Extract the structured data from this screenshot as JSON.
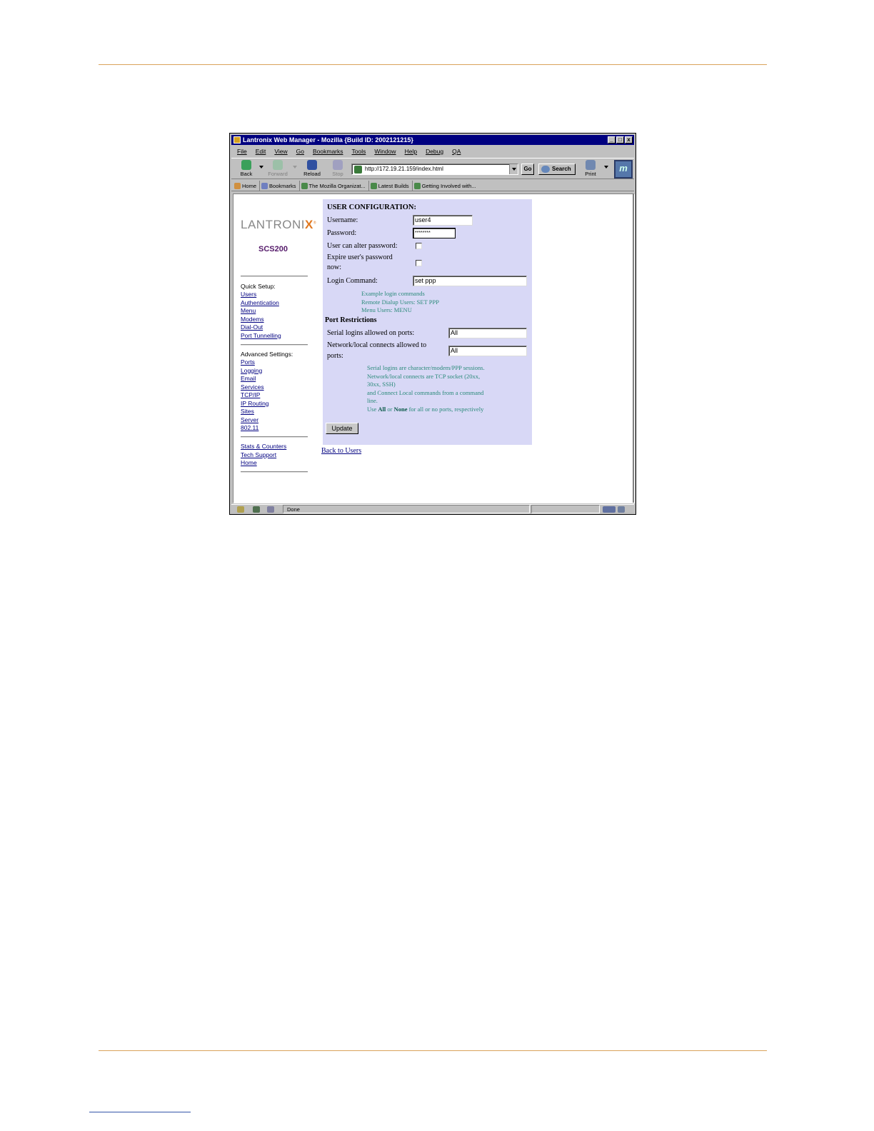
{
  "window": {
    "title": "Lantronix Web Manager - Mozilla {Build ID: 2002121215}",
    "buttons": [
      "_",
      "□",
      "x"
    ]
  },
  "menubar": [
    "File",
    "Edit",
    "View",
    "Go",
    "Bookmarks",
    "Tools",
    "Window",
    "Help",
    "Debug",
    "QA"
  ],
  "toolbar": {
    "back": "Back",
    "forward": "Forward",
    "reload": "Reload",
    "stop": "Stop",
    "url": "http://172.19.21.159/index.html",
    "go": "Go",
    "search": "Search",
    "print": "Print"
  },
  "personal_bar": [
    "Home",
    "Bookmarks",
    "The Mozilla Organizat...",
    "Latest Builds",
    "Getting Involved with..."
  ],
  "sidebar": {
    "logo_text": "LANTRONI",
    "logo_x": "X",
    "model": "SCS200",
    "quick_setup_heading": "Quick Setup:",
    "quick_setup": [
      "Users",
      "Authentication",
      "Menu",
      "Modems",
      "Dial-Out",
      "Port Tunnelling"
    ],
    "advanced_heading": "Advanced Settings:",
    "advanced": [
      "Ports",
      "Logging",
      "Email",
      "Services",
      "TCP/IP",
      "IP Routing",
      "Sites",
      "Server",
      "802.11"
    ],
    "misc": [
      "Stats & Counters",
      "Tech Support",
      "Home"
    ]
  },
  "form": {
    "heading": "USER CONFIGURATION:",
    "username_label": "Username:",
    "username_value": "user4",
    "password_label": "Password:",
    "password_value": "********",
    "alter_label": "User can alter password:",
    "expire_label_1": "Expire user's password",
    "expire_label_2": "now:",
    "login_label": "Login Command:",
    "login_value": "set ppp",
    "example_hint": [
      "Example login commands",
      "Remote Dialup Users: SET PPP",
      "Menu Users: MENU"
    ],
    "port_heading": "Port Restrictions",
    "serial_label": "Serial logins allowed on ports:",
    "serial_value": "All",
    "network_label_1": "Network/local connects allowed to",
    "network_label_2": "ports:",
    "network_value": "All",
    "port_hint": [
      "Serial logins are character/modem/PPP sessions.",
      "Network/local connects are TCP socket (20xx,",
      "30xx, SSH)",
      "and Connect Local commands from a command",
      "line."
    ],
    "port_hint_use": "Use ",
    "port_hint_all": "All",
    "port_hint_or": " or ",
    "port_hint_none": "None",
    "port_hint_tail": " for all or no ports, respectively",
    "update_button": "Update",
    "back_link": "Back to Users"
  },
  "status": {
    "text": "Done"
  },
  "colors": {
    "panel_bg": "#d8d8f6",
    "hint_text": "#2a8a7a",
    "title_bar": "#000080",
    "page_rule": "#d9a25a"
  }
}
